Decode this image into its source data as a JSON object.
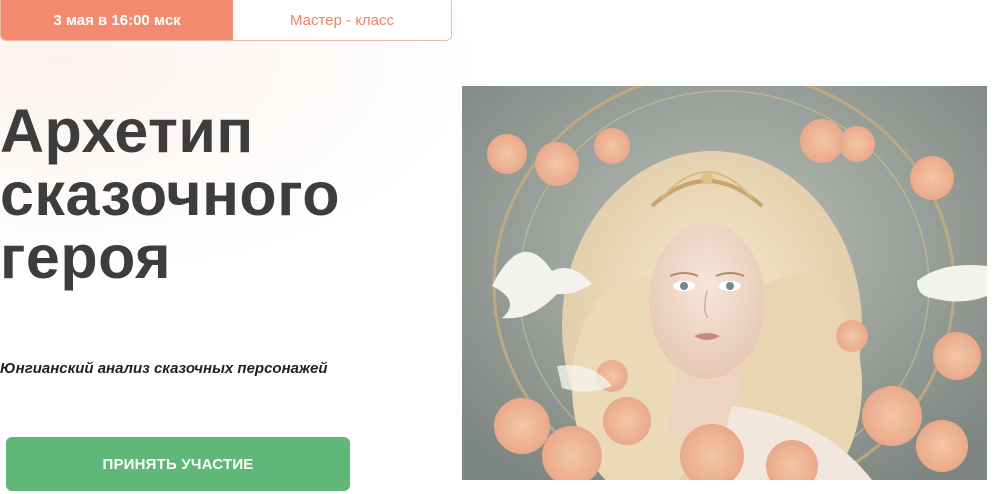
{
  "badge": {
    "date": "3 мая в 16:00 мск",
    "type": "Мастер - класс"
  },
  "title": {
    "line1": "Архетип",
    "line2": "сказочного",
    "line3": "героя"
  },
  "subtitle": "Юнгианский анализ сказочных персонажей",
  "cta": {
    "label": "ПРИНЯТЬ УЧАСТИЕ"
  },
  "colors": {
    "accent_orange": "#f48a6f",
    "cta_green": "#5fb878",
    "title_text": "#3d3d3d"
  }
}
